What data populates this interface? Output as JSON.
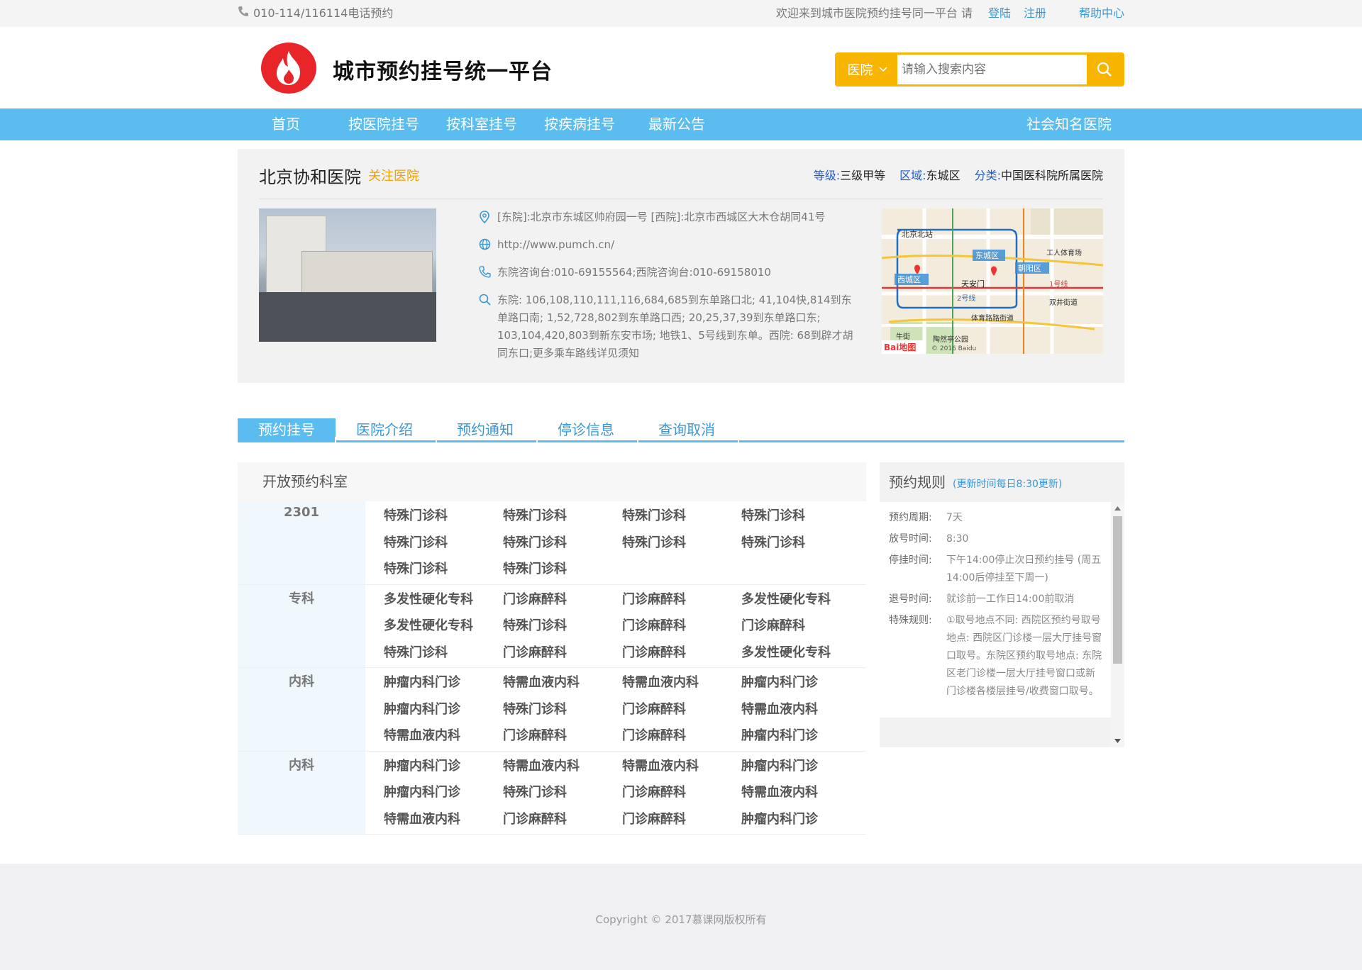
{
  "topbar": {
    "phone": "010-114/116114电话预约",
    "welcome": "欢迎来到城市医院预约挂号同一平台 请",
    "login": "登陆",
    "register": "注册",
    "help": "帮助中心"
  },
  "header": {
    "brand": "城市预约挂号统一平台",
    "search_type": "医院",
    "search_placeholder": "请输入搜索内容"
  },
  "nav": {
    "items": [
      "首页",
      "按医院挂号",
      "按科室挂号",
      "按疾病挂号",
      "最新公告"
    ],
    "right": "社会知名医院"
  },
  "hospital": {
    "name": "北京协和医院",
    "follow": "关注医院",
    "level_k": "等级:",
    "level_v": "三级甲等",
    "area_k": "区域:",
    "area_v": "东城区",
    "type_k": "分类:",
    "type_v": "中国医科院所属医院",
    "address": "[东院]:北京市东城区帅府园一号 [西院]:北京市西城区大木仓胡同41号",
    "website": "http://www.pumch.cn/",
    "phone": "东院咨询台:010-69155564;西院咨询台:010-69158010",
    "route": "东院: 106,108,110,111,116,684,685到东单路口北; 41,104快,814到东单路口南; 1,52,728,802到东单路口西; 20,25,37,39到东单路口东; 103,104,420,803到新东安市场; 地铁1、5号线到东单。西院: 68到辟才胡同东口;更多乘车路线详见须知",
    "map": {
      "labels": [
        "北京北站",
        "东城区",
        "朝阳区",
        "西城区",
        "天安门",
        "2号线",
        "1号线",
        "工人体育场",
        "双井街道",
        "体育路路街道",
        "牛街",
        "陶然亭公园",
        "© 2016 Baidu"
      ],
      "logo": "Bai地图"
    }
  },
  "tabs": [
    "预约挂号",
    "医院介绍",
    "预约通知",
    "停诊信息",
    "查询取消"
  ],
  "departments": {
    "title": "开放预约科室",
    "groups": [
      {
        "cat": "2301",
        "items": [
          "特殊门诊科",
          "特殊门诊科",
          "特殊门诊科",
          "特殊门诊科",
          "特殊门诊科",
          "特殊门诊科",
          "特殊门诊科",
          "特殊门诊科",
          "特殊门诊科",
          "特殊门诊科"
        ]
      },
      {
        "cat": "专科",
        "items": [
          "多发性硬化专科",
          "门诊麻醉科",
          "门诊麻醉科",
          "多发性硬化专科",
          "多发性硬化专科",
          "特殊门诊科",
          "门诊麻醉科",
          "门诊麻醉科",
          "特殊门诊科",
          "门诊麻醉科",
          "门诊麻醉科",
          "多发性硬化专科"
        ]
      },
      {
        "cat": "内科",
        "items": [
          "肿瘤内科门诊",
          "特需血液内科",
          "特需血液内科",
          "肿瘤内科门诊",
          "肿瘤内科门诊",
          "特殊门诊科",
          "门诊麻醉科",
          "特需血液内科",
          "特需血液内科",
          "门诊麻醉科",
          "门诊麻醉科",
          "肿瘤内科门诊"
        ]
      },
      {
        "cat": "内科",
        "items": [
          "肿瘤内科门诊",
          "特需血液内科",
          "特需血液内科",
          "肿瘤内科门诊",
          "肿瘤内科门诊",
          "特殊门诊科",
          "门诊麻醉科",
          "特需血液内科",
          "特需血液内科",
          "门诊麻醉科",
          "门诊麻醉科",
          "肿瘤内科门诊"
        ]
      }
    ]
  },
  "rules": {
    "title": "预约规则",
    "update": "(更新时间每日8:30更新)",
    "rows": [
      {
        "k": "预约周期:",
        "v": "7天"
      },
      {
        "k": "放号时间:",
        "v": "8:30"
      },
      {
        "k": "停挂时间:",
        "v": "下午14:00停止次日预约挂号 (周五14:00后停挂至下周一)"
      },
      {
        "k": "退号时间:",
        "v": "就诊前一工作日14:00前取消"
      },
      {
        "k": "特殊规则:",
        "v": "①取号地点不同: 西院区预约号取号地点: 西院区门诊楼一层大厅挂号窗口取号。东院区预约取号地点: 东院区老门诊楼一层大厅挂号窗口或新门诊楼各楼层挂号/收费窗口取号。"
      }
    ]
  },
  "footer": {
    "copyright": "Copyright © 2017慕课网版权所有"
  },
  "colors": {
    "nav": "#5bbcf0",
    "accent": "#f7b500",
    "link": "#3a97d4",
    "logo": "#e8262a"
  }
}
